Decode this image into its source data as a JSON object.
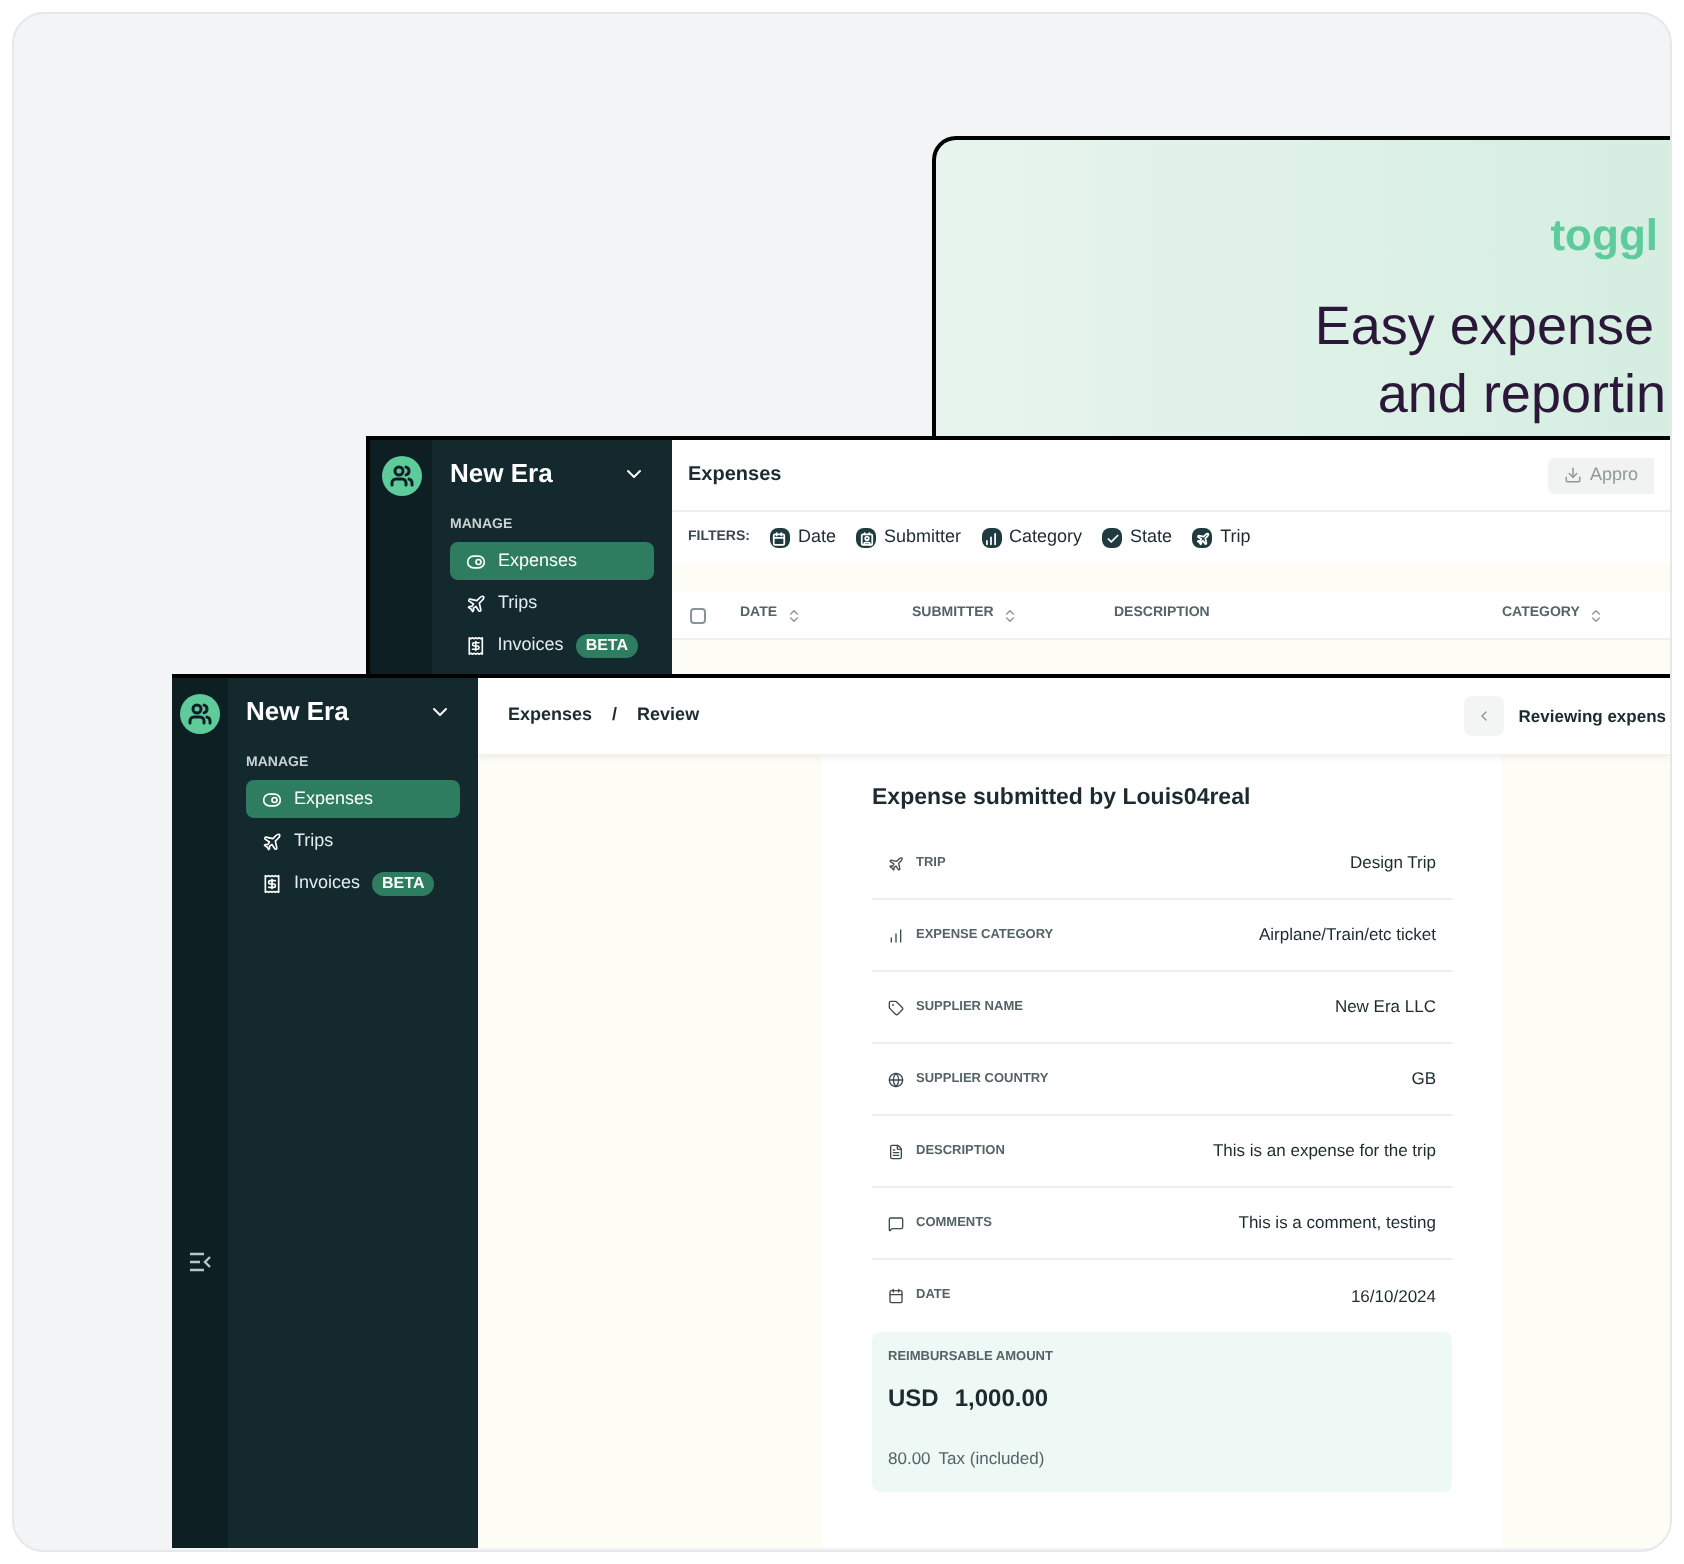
{
  "promo": {
    "logo": "toggl",
    "headline": [
      "Easy expense",
      "and reportin"
    ]
  },
  "back_window": {
    "workspace": "New Era",
    "section": "MANAGE",
    "nav": [
      {
        "label": "Expenses",
        "selected": true
      },
      {
        "label": "Trips",
        "selected": false
      },
      {
        "label": "Invoices",
        "selected": false,
        "badge": "BETA"
      }
    ],
    "title": "Expenses",
    "action": "Appro",
    "select_all_checked": false,
    "filters_label": "FILTERS:",
    "filters": [
      "Date",
      "Submitter",
      "Category",
      "State",
      "Trip"
    ],
    "columns": [
      {
        "label": "DATE",
        "sortable": true
      },
      {
        "label": "SUBMITTER",
        "sortable": true
      },
      {
        "label": "DESCRIPTION",
        "sortable": false
      },
      {
        "label": "CATEGORY",
        "sortable": true
      }
    ]
  },
  "front_window": {
    "workspace": "New Era",
    "section": "MANAGE",
    "nav": [
      {
        "label": "Expenses",
        "selected": true
      },
      {
        "label": "Trips",
        "selected": false
      },
      {
        "label": "Invoices",
        "selected": false,
        "badge": "BETA"
      }
    ],
    "breadcrumb": [
      "Expenses",
      "Review"
    ],
    "breadcrumb_separator": "/",
    "reviewing": "Reviewing expens",
    "card": {
      "title": "Expense submitted by Louis04real",
      "fields": [
        {
          "label": "TRIP",
          "value": "Design Trip"
        },
        {
          "label": "EXPENSE CATEGORY",
          "value": "Airplane/Train/etc ticket"
        },
        {
          "label": "SUPPLIER NAME",
          "value": "New Era LLC"
        },
        {
          "label": "SUPPLIER COUNTRY",
          "value": "GB"
        },
        {
          "label": "DESCRIPTION",
          "value": "This is an expense for the trip"
        },
        {
          "label": "COMMENTS",
          "value": "This is a comment, testing"
        },
        {
          "label": "DATE",
          "value": "16/10/2024"
        }
      ],
      "amount": {
        "label": "REIMBURSABLE AMOUNT",
        "currency": "USD",
        "value": "1,000.00",
        "tax_value": "80.00",
        "tax_label": "Tax (included)"
      }
    }
  }
}
